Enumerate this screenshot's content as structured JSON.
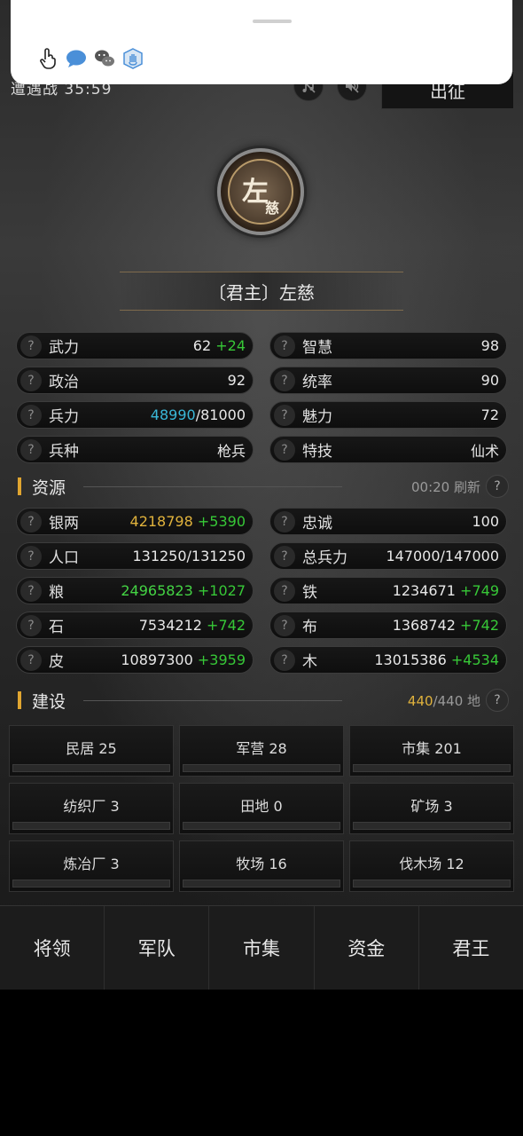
{
  "overlay": {
    "icons": [
      "hand-pointer-icon",
      "chat-bubble-icon",
      "wechat-icon",
      "hand-shield-icon"
    ]
  },
  "header": {
    "battle_timer": "遭遇战 35:59",
    "march_label": "出征"
  },
  "hero": {
    "avatar_char_main": "左",
    "avatar_char_sub": "慈",
    "name": "〔君主〕左慈"
  },
  "attributes": [
    {
      "label": "武力",
      "value": "62",
      "bonus": "+24"
    },
    {
      "label": "智慧",
      "value": "98",
      "bonus": ""
    },
    {
      "label": "政治",
      "value": "92",
      "bonus": ""
    },
    {
      "label": "统率",
      "value": "90",
      "bonus": ""
    },
    {
      "label": "兵力",
      "value": "48990",
      "max": "/81000"
    },
    {
      "label": "魅力",
      "value": "72",
      "bonus": ""
    },
    {
      "label": "兵种",
      "value": "枪兵",
      "bonus": ""
    },
    {
      "label": "特技",
      "value": "仙术",
      "bonus": ""
    }
  ],
  "resources_header": {
    "title": "资源",
    "refresh": "00:20 刷新"
  },
  "resources": [
    {
      "label": "银两",
      "value": "4218798",
      "bonus": "+5390"
    },
    {
      "label": "忠诚",
      "value": "100",
      "bonus": ""
    },
    {
      "label": "人口",
      "value": "131250/131250",
      "bonus": ""
    },
    {
      "label": "总兵力",
      "value": "147000/147000",
      "bonus": ""
    },
    {
      "label": "粮",
      "value": "24965823",
      "bonus": "+1027"
    },
    {
      "label": "铁",
      "value": "1234671",
      "bonus": "+749"
    },
    {
      "label": "石",
      "value": "7534212",
      "bonus": "+742"
    },
    {
      "label": "布",
      "value": "1368742",
      "bonus": "+742"
    },
    {
      "label": "皮",
      "value": "10897300",
      "bonus": "+3959"
    },
    {
      "label": "木",
      "value": "13015386",
      "bonus": "+4534"
    }
  ],
  "build_header": {
    "title": "建设",
    "used": "440",
    "total": "/440 地"
  },
  "buildings": [
    {
      "label": "民居 25"
    },
    {
      "label": "军营 28"
    },
    {
      "label": "市集 201"
    },
    {
      "label": "纺织厂 3"
    },
    {
      "label": "田地 0"
    },
    {
      "label": "矿场 3"
    },
    {
      "label": "炼冶厂 3"
    },
    {
      "label": "牧场 16"
    },
    {
      "label": "伐木场 12"
    }
  ],
  "nav": [
    "将领",
    "军队",
    "市集",
    "资金",
    "君王"
  ],
  "colors": {
    "accent_gold": "#e0b23c",
    "bonus_green": "#37c837",
    "troops_cyan": "#3ab8d8"
  }
}
